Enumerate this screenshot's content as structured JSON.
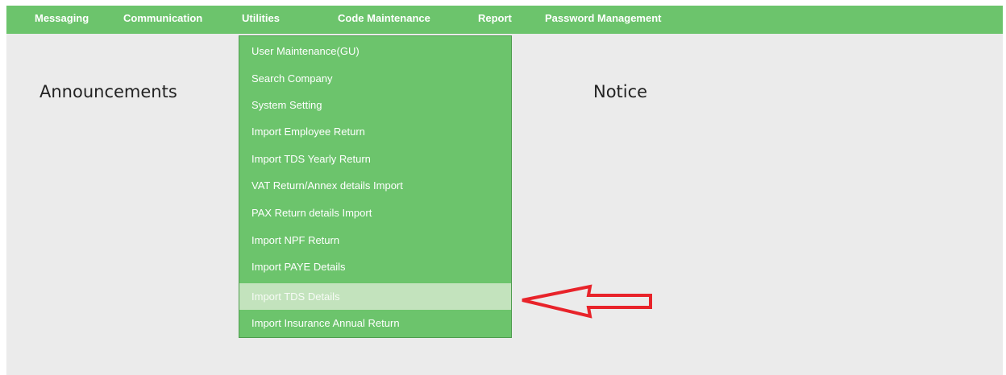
{
  "nav": {
    "items": [
      {
        "label": "Messaging"
      },
      {
        "label": "Communication"
      },
      {
        "label": "Utilities"
      },
      {
        "label": "Code Maintenance"
      },
      {
        "label": "Report"
      },
      {
        "label": "Password Management"
      }
    ]
  },
  "main": {
    "announcements_title": "Announcements",
    "notice_title": "Notice"
  },
  "utilities_menu": {
    "items": [
      {
        "label": "User Maintenance(GU)"
      },
      {
        "label": "Search Company"
      },
      {
        "label": "System Setting"
      },
      {
        "label": "Import Employee Return"
      },
      {
        "label": "Import TDS Yearly Return"
      },
      {
        "label": "VAT Return/Annex details Import"
      },
      {
        "label": "PAX Return details Import"
      },
      {
        "label": "Import NPF Return"
      },
      {
        "label": "Import PAYE Details"
      },
      {
        "label": "Import TDS Details"
      },
      {
        "label": "Import Insurance Annual Return"
      }
    ],
    "highlighted_label": "Import TDS Details"
  },
  "colors": {
    "nav_bg": "#6cc46c",
    "menu_bg": "#6cc46c",
    "menu_hover": "#c3e3bd",
    "content_bg": "#ebebeb",
    "annotation_arrow": "#e8232a"
  },
  "icons": {
    "annotation": "red-arrow-icon"
  }
}
